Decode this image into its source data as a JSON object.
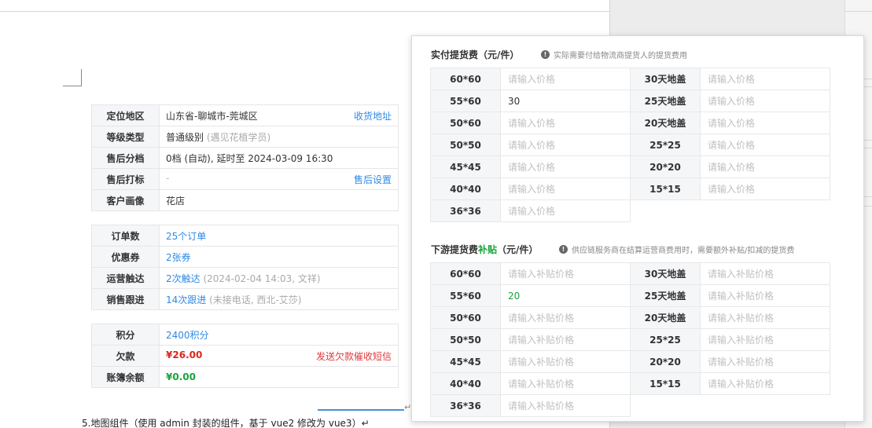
{
  "document": {
    "location_table": [
      {
        "label": "定位地区",
        "value": "山东省-聊城市-莞城区",
        "action": "收货地址"
      },
      {
        "label": "等级类型",
        "value": "普通级别",
        "note": "(遇见花植学员)"
      },
      {
        "label": "售后分档",
        "value": "0档 (自动), 延时至 2024-03-09 16:30"
      },
      {
        "label": "售后打标",
        "value": "-",
        "action": "售后设置"
      },
      {
        "label": "客户画像",
        "value": "花店"
      }
    ],
    "order_table": [
      {
        "label": "订单数",
        "value": "25个订单"
      },
      {
        "label": "优惠券",
        "value": "2张券"
      },
      {
        "label": "运营触达",
        "value": "2次触达",
        "note": "(2024-02-04 14:03, 文祥)"
      },
      {
        "label": "销售跟进",
        "value": "14次跟进",
        "note": "(未接电话, 西北-艾莎)"
      }
    ],
    "account_table": [
      {
        "label": "积分",
        "value": "2400积分"
      },
      {
        "label": "欠款",
        "value": "¥26.00",
        "action": "发送欠款催收短信"
      },
      {
        "label": "账簿余额",
        "value": "¥0.00"
      }
    ],
    "caption": "5.地图组件（使用 admin 封装的组件，基于 vue2 修改为 vue3）↵",
    "cursor_mark": "↵"
  },
  "panel": {
    "section1": {
      "title": "实付提货费（元/件）",
      "note": "实际需要付给物流商提货人的提货费用",
      "rows": [
        [
          {
            "k": "60*60",
            "v": "",
            "ph": "请输入价格"
          },
          {
            "k": "30天地盖",
            "v": "",
            "ph": "请输入价格"
          }
        ],
        [
          {
            "k": "55*60",
            "v": "30",
            "ph": "请输入价格"
          },
          {
            "k": "25天地盖",
            "v": "",
            "ph": "请输入价格"
          }
        ],
        [
          {
            "k": "50*60",
            "v": "",
            "ph": "请输入价格"
          },
          {
            "k": "20天地盖",
            "v": "",
            "ph": "请输入价格"
          }
        ],
        [
          {
            "k": "50*50",
            "v": "",
            "ph": "请输入价格"
          },
          {
            "k": "25*25",
            "v": "",
            "ph": "请输入价格"
          }
        ],
        [
          {
            "k": "45*45",
            "v": "",
            "ph": "请输入价格"
          },
          {
            "k": "20*20",
            "v": "",
            "ph": "请输入价格"
          }
        ],
        [
          {
            "k": "40*40",
            "v": "",
            "ph": "请输入价格"
          },
          {
            "k": "15*15",
            "v": "",
            "ph": "请输入价格"
          }
        ],
        [
          {
            "k": "36*36",
            "v": "",
            "ph": "请输入价格"
          }
        ]
      ]
    },
    "section2": {
      "title_prefix": "下游提货费",
      "title_highlight": "补贴",
      "title_suffix": "（元/件）",
      "note": "供应链服务商在结算运营商费用时，需要额外补贴/扣减的提货费",
      "rows": [
        [
          {
            "k": "60*60",
            "v": "",
            "ph": "请输入补贴价格"
          },
          {
            "k": "30天地盖",
            "v": "",
            "ph": "请输入补贴价格"
          }
        ],
        [
          {
            "k": "55*60",
            "v": "20",
            "ph": "请输入补贴价格"
          },
          {
            "k": "25天地盖",
            "v": "",
            "ph": "请输入补贴价格"
          }
        ],
        [
          {
            "k": "50*60",
            "v": "",
            "ph": "请输入补贴价格"
          },
          {
            "k": "20天地盖",
            "v": "",
            "ph": "请输入补贴价格"
          }
        ],
        [
          {
            "k": "50*50",
            "v": "",
            "ph": "请输入补贴价格"
          },
          {
            "k": "25*25",
            "v": "",
            "ph": "请输入补贴价格"
          }
        ],
        [
          {
            "k": "45*45",
            "v": "",
            "ph": "请输入补贴价格"
          },
          {
            "k": "20*20",
            "v": "",
            "ph": "请输入补贴价格"
          }
        ],
        [
          {
            "k": "40*40",
            "v": "",
            "ph": "请输入补贴价格"
          },
          {
            "k": "15*15",
            "v": "",
            "ph": "请输入补贴价格"
          }
        ],
        [
          {
            "k": "36*36",
            "v": "",
            "ph": "请输入补贴价格"
          }
        ]
      ]
    }
  },
  "colors": {
    "link": "#2f8ae5",
    "red": "#d9261c",
    "green": "#1aa33a",
    "placeholder": "#c0c0c0"
  },
  "icons": {
    "note_icon": "info-circle-icon"
  }
}
